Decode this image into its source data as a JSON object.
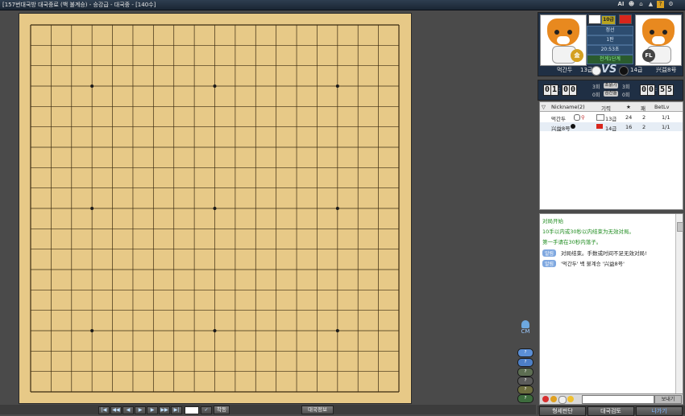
{
  "window": {
    "title": "[157번대국방 대국중료 (백 불계승) - 승강급 - 대국중 - [140수]",
    "ai_label": "AI"
  },
  "board": {
    "size": 19,
    "background": "#e7c987"
  },
  "bottombar": {
    "first": "|◀",
    "prev10": "◀◀",
    "prev": "◀",
    "play": "▶",
    "next": "▶",
    "next10": "▶▶",
    "last": "▶|",
    "move_input": "",
    "goto_label": "착동",
    "game_info_label": "대국정보"
  },
  "sidecm": {
    "label": "CM",
    "pills": [
      "?",
      "?",
      "?",
      "?",
      "?",
      "?"
    ]
  },
  "players": {
    "left": {
      "name": "먹간두",
      "rank": "13급",
      "stone": "white",
      "country": "KR",
      "badge": "金"
    },
    "right": {
      "name": "兴益8号",
      "rank": "14급",
      "stone": "black",
      "country": "CN",
      "badge": "FL"
    },
    "vs_text": "VS",
    "info": {
      "row1": "10급",
      "row2": "정선",
      "row3": "1판",
      "row4": "20:53초",
      "row5": "천계1단계"
    }
  },
  "clock": {
    "left_digits": [
      "0",
      "1",
      "0",
      "0"
    ],
    "right_digits": [
      "0",
      "0",
      "5",
      "5"
    ],
    "left_count_top": "3회",
    "right_count_top": "3회",
    "left_count_bottom": "0회",
    "right_count_bottom": "0회",
    "overtime_btn": "초읽기",
    "bonus_btn": "점찬돌"
  },
  "player_list": {
    "headers": {
      "nickname": "Nickname(2)",
      "rank": "기력",
      "star": "★",
      "win": "패",
      "betlv": "BetLv"
    },
    "rows": [
      {
        "nickname": "먹간두",
        "rank": "13급",
        "star": "24",
        "win": "2",
        "betlv": "1/1"
      },
      {
        "nickname": "兴益8号",
        "rank": "14급",
        "star": "16",
        "win": "2",
        "betlv": "1/1"
      }
    ]
  },
  "chat": {
    "lines": [
      {
        "text": "对局开始",
        "color": "#1f8c1f"
      },
      {
        "text": "10手以内或30秒以内结束为无效对局。",
        "color": "#1f8c1f"
      },
      {
        "text": "第一手请在30秒内落子。",
        "color": "#1f8c1f"
      }
    ],
    "system_badge": "알림",
    "system_msgs": [
      "对局结束。手数或时间不足无效对局!",
      "'먹간두' 백 불계승 '兴益8号'"
    ],
    "send_label": "보내기"
  },
  "tabs": [
    "형세판단",
    "대국검토",
    "나가기"
  ]
}
